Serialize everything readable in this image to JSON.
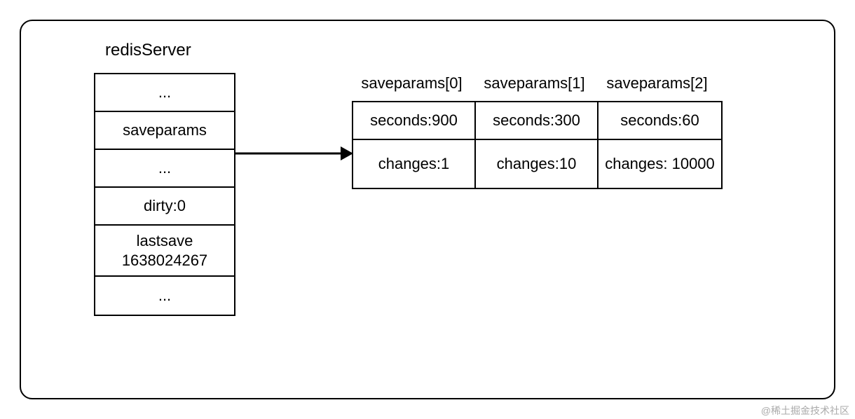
{
  "struct": {
    "title": "redisServer",
    "rows": {
      "r0": "...",
      "r1": "saveparams",
      "r2": "...",
      "r3": "dirty:0",
      "r4a": "lastsave",
      "r4b": "1638024267",
      "r5": "..."
    }
  },
  "array": {
    "labels": {
      "l0": "saveparams[0]",
      "l1": "saveparams[1]",
      "l2": "saveparams[2]"
    },
    "cells": {
      "c00": "seconds:900",
      "c01": "seconds:300",
      "c02": "seconds:60",
      "c10": "changes:1",
      "c11": "changes:10",
      "c12": "changes: 10000"
    }
  },
  "watermark": "@稀土掘金技术社区"
}
